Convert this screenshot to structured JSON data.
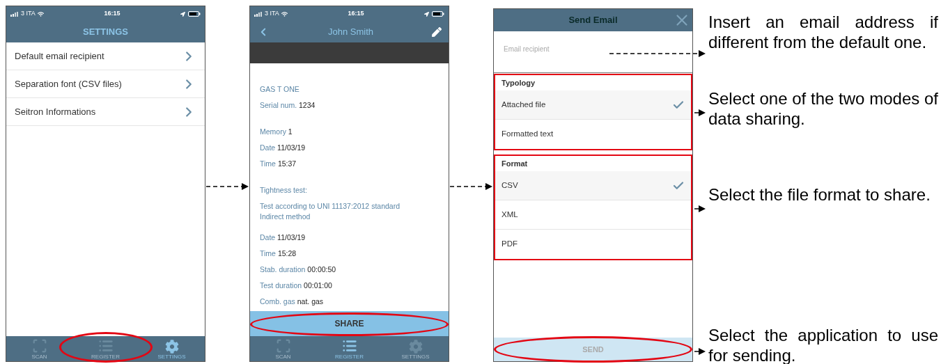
{
  "settings_screen": {
    "status": {
      "carrier": "3 ITA",
      "time": "16:15"
    },
    "title": "SETTINGS",
    "items": [
      "Default email recipient",
      "Separation font (CSV files)",
      "Seitron Informations"
    ],
    "tabs": [
      {
        "label": "SCAN",
        "selected": false,
        "circled": false
      },
      {
        "label": "REGISTER",
        "selected": false,
        "circled": true
      },
      {
        "label": "SETTINGS",
        "selected": true,
        "circled": false
      }
    ]
  },
  "record_screen": {
    "status": {
      "carrier": "3 ITA",
      "time": "16:15"
    },
    "title": "John Smith",
    "groups": [
      [
        {
          "label": "GAS T ONE"
        },
        {
          "label": "Serial num.",
          "value": "1234"
        }
      ],
      [
        {
          "label": "Memory",
          "value": "1"
        },
        {
          "label": "Date",
          "value": "11/03/19"
        },
        {
          "label": "Time",
          "value": "15:37"
        }
      ],
      [
        {
          "label": "Tightness test:"
        },
        {
          "label": "Test according to UNI 11137:2012 standard Indirect method"
        }
      ],
      [
        {
          "label": "Date",
          "value": "11/03/19"
        },
        {
          "label": "Time",
          "value": "15:28"
        },
        {
          "label": "Stab. duration",
          "value": "00:00:50"
        },
        {
          "label": "Test duration",
          "value": "00:01:00"
        },
        {
          "label": "Comb. gas",
          "value": "nat. gas"
        }
      ]
    ],
    "share_button": {
      "label": "SHARE",
      "circled": true
    },
    "tabs": [
      {
        "label": "SCAN",
        "selected": false,
        "circled": false
      },
      {
        "label": "REGISTER",
        "selected": true,
        "circled": false
      },
      {
        "label": "SETTINGS",
        "selected": false,
        "circled": false
      }
    ]
  },
  "email_screen": {
    "title": "Send Email",
    "recipient": {
      "placeholder": "Email recipient"
    },
    "sections": [
      {
        "title": "Typology",
        "outlined": true,
        "options": [
          {
            "label": "Attached file",
            "selected": true
          },
          {
            "label": "Formatted text",
            "selected": false
          }
        ]
      },
      {
        "title": "Format",
        "outlined": true,
        "options": [
          {
            "label": "CSV",
            "selected": true
          },
          {
            "label": "XML",
            "selected": false
          },
          {
            "label": "PDF",
            "selected": false
          }
        ]
      }
    ],
    "send_button": {
      "label": "SEND",
      "disabled": true,
      "circled": true
    }
  },
  "annotations": [
    {
      "text": "Insert an email address if different from the default one."
    },
    {
      "text": "Select one of the two modes of data sharing."
    },
    {
      "text": "Select the file format to share."
    },
    {
      "text": "Select the application to use for sending."
    }
  ]
}
